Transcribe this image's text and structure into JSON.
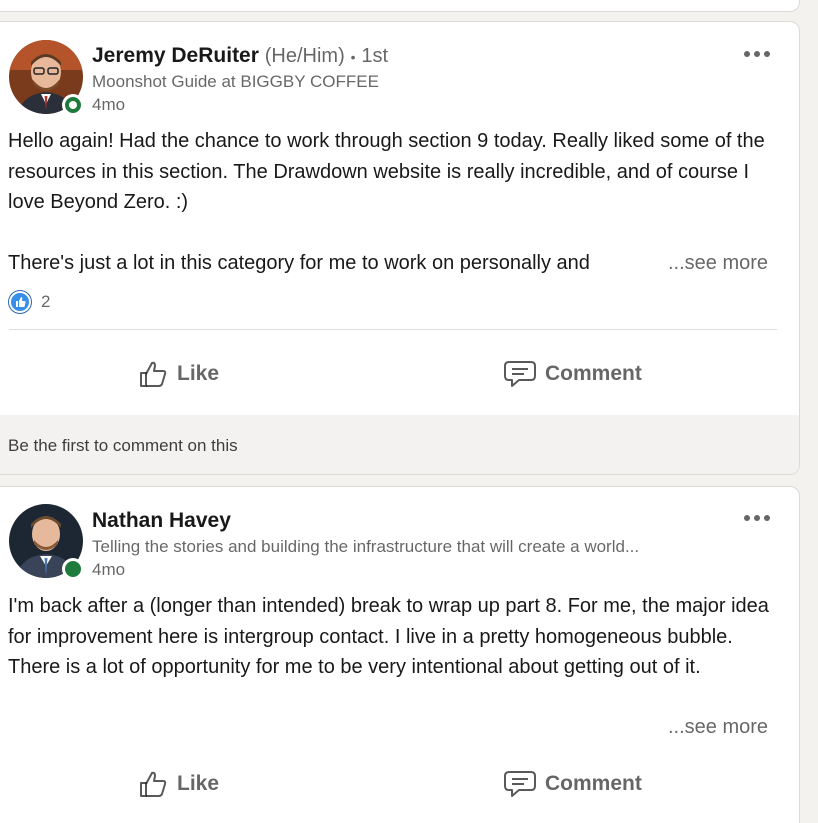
{
  "posts": [
    {
      "author": {
        "name": "Jeremy DeRuiter",
        "pronouns": "(He/Him)",
        "separator": "•",
        "degree": "1st",
        "headline": "Moonshot Guide at BIGGBY COFFEE",
        "time": "4mo"
      },
      "body": "Hello again! Had the chance to work through section 9 today. Really liked some of the resources in this section. The Drawdown website is really incredible, and of course I love Beyond Zero. :)\n\nThere's just a lot in this category for me to work on personally and",
      "see_more": "...see more",
      "reaction_count": "2",
      "actions": {
        "like": "Like",
        "comment": "Comment"
      },
      "comments_empty": "Be the first to comment on this"
    },
    {
      "author": {
        "name": "Nathan Havey",
        "headline": "Telling the stories and building the infrastructure that will create a world...",
        "time": "4mo"
      },
      "body": "I'm back after a (longer than intended) break to wrap up part 8. For me, the major idea for improvement here is intergroup contact. I live in a pretty homogeneous bubble. There is a lot of opportunity for me to be very intentional about getting out of it.",
      "see_more": "...see more",
      "actions": {
        "like": "Like",
        "comment": "Comment"
      }
    }
  ],
  "colors": {
    "presence_online": "#1e7b3c",
    "like_blue": "#378fe9",
    "muted_text": "rgba(0,0,0,0.6)",
    "comment_bg": "#f3f2f0"
  },
  "icons": {
    "more": "more-horizontal-icon",
    "like": "thumbs-up-icon",
    "comment": "speech-bubble-icon",
    "reaction": "like-reaction-icon"
  }
}
